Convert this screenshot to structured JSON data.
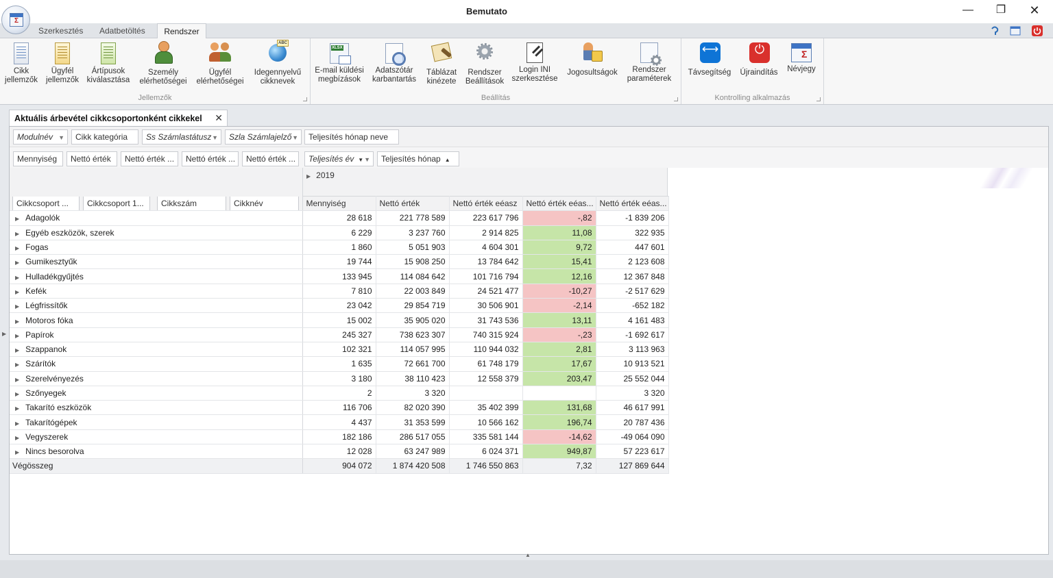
{
  "window": {
    "title": "Bemutato",
    "minimize": "—",
    "restore": "❐",
    "close": "✕"
  },
  "ribbon_tabs": [
    "Szerkesztés",
    "Adatbetöltés",
    "Rendszer"
  ],
  "ribbon_groups": [
    {
      "label": "Jellemzők",
      "buttons": [
        {
          "label1": "Cikk",
          "label2": "jellemzők",
          "icon": "document-icon"
        },
        {
          "label1": "Ügyfél",
          "label2": "jellemzők",
          "icon": "document-yellow-icon"
        },
        {
          "label1": "Ártípusok",
          "label2": "kiválasztása",
          "icon": "document-green-icon"
        },
        {
          "label1": "Személy",
          "label2": "elérhetőségei",
          "icon": "person-icon"
        },
        {
          "label1": "Ügyfél",
          "label2": "elérhetőségei",
          "icon": "people-icon"
        },
        {
          "label1": "Idegennyelvű",
          "label2": "cikknevek",
          "icon": "globe-icon"
        }
      ]
    },
    {
      "label": "Beállítás",
      "buttons": [
        {
          "label1": "E-mail küldési",
          "label2": "megbízások",
          "icon": "email-icon"
        },
        {
          "label1": "Adatszótár",
          "label2": "karbantartás",
          "icon": "dictionary-icon"
        },
        {
          "label1": "Táblázat",
          "label2": "kinézete",
          "icon": "table-style-icon"
        },
        {
          "label1": "Rendszer",
          "label2": "Beállítások",
          "icon": "gear-icon"
        },
        {
          "label1": "Login INI",
          "label2": "szerkesztése",
          "icon": "ini-edit-icon"
        },
        {
          "label1": "Jogosultságok",
          "label2": "",
          "icon": "permissions-icon"
        },
        {
          "label1": "Rendszer",
          "label2": "paraméterek",
          "icon": "parameters-icon"
        }
      ]
    },
    {
      "label": "Kontrolling alkalmazás",
      "buttons": [
        {
          "label1": "Távsegítség",
          "label2": "",
          "icon": "teamviewer-icon"
        },
        {
          "label1": "Újraindítás",
          "label2": "",
          "icon": "power-icon"
        },
        {
          "label1": "Névjegy",
          "label2": "",
          "icon": "about-icon"
        }
      ]
    }
  ],
  "document_tab": {
    "title": "Aktuális árbevétel cikkcsoportonként cikkekel",
    "close": "✕"
  },
  "filter_fields": [
    "Modulnév",
    "Cikk kategória",
    "Ss Számlastátusz",
    "Szla Számlajelző",
    "Teljesítés hónap neve"
  ],
  "data_fields": [
    "Mennyiség",
    "Nettó érték",
    "Nettó érték ...",
    "Nettó érték ...",
    "Nettó érték ..."
  ],
  "column_fields": [
    "Teljesítés év",
    "Teljesítés hónap"
  ],
  "row_fields": [
    "Cikkcsoport ...",
    "Cikkcsoport 1...",
    "Cikkszám",
    "Cikknév"
  ],
  "year": "2019",
  "column_headers": [
    "Mennyiség",
    "Nettó érték",
    "Nettó érték eéasz",
    "Nettó érték eéas...",
    "Nettó érték eéas..."
  ],
  "rows": [
    {
      "name": "Adagolók",
      "v": [
        "28 618",
        "221 778 589",
        "223 617 796",
        "-,82",
        "-1 839 206"
      ],
      "s": "neg"
    },
    {
      "name": "Egyéb eszközök, szerek",
      "v": [
        "6 229",
        "3 237 760",
        "2 914 825",
        "11,08",
        "322 935"
      ],
      "s": "pos"
    },
    {
      "name": "Fogas",
      "v": [
        "1 860",
        "5 051 903",
        "4 604 301",
        "9,72",
        "447 601"
      ],
      "s": "pos"
    },
    {
      "name": "Gumikesztyűk",
      "v": [
        "19 744",
        "15 908 250",
        "13 784 642",
        "15,41",
        "2 123 608"
      ],
      "s": "pos"
    },
    {
      "name": "Hulladékgyűjtés",
      "v": [
        "133 945",
        "114 084 642",
        "101 716 794",
        "12,16",
        "12 367 848"
      ],
      "s": "pos"
    },
    {
      "name": "Kefék",
      "v": [
        "7 810",
        "22 003 849",
        "24 521 477",
        "-10,27",
        "-2 517 629"
      ],
      "s": "neg"
    },
    {
      "name": "Légfrissítők",
      "v": [
        "23 042",
        "29 854 719",
        "30 506 901",
        "-2,14",
        "-652 182"
      ],
      "s": "neg"
    },
    {
      "name": "Motoros fóka",
      "v": [
        "15 002",
        "35 905 020",
        "31 743 536",
        "13,11",
        "4 161 483"
      ],
      "s": "pos"
    },
    {
      "name": "Papírok",
      "v": [
        "245 327",
        "738 623 307",
        "740 315 924",
        "-,23",
        "-1 692 617"
      ],
      "s": "neg"
    },
    {
      "name": "Szappanok",
      "v": [
        "102 321",
        "114 057 995",
        "110 944 032",
        "2,81",
        "3 113 963"
      ],
      "s": "pos"
    },
    {
      "name": "Szárítók",
      "v": [
        "1 635",
        "72 661 700",
        "61 748 179",
        "17,67",
        "10 913 521"
      ],
      "s": "pos"
    },
    {
      "name": "Szerelvényezés",
      "v": [
        "3 180",
        "38 110 423",
        "12 558 379",
        "203,47",
        "25 552 044"
      ],
      "s": "pos"
    },
    {
      "name": "Szőnyegek",
      "v": [
        "2",
        "3 320",
        "",
        "",
        "3 320"
      ],
      "s": "none"
    },
    {
      "name": "Takarító eszközök",
      "v": [
        "116 706",
        "82 020 390",
        "35 402 399",
        "131,68",
        "46 617 991"
      ],
      "s": "pos"
    },
    {
      "name": "Takarítógépek",
      "v": [
        "4 437",
        "31 353 599",
        "10 566 162",
        "196,74",
        "20 787 436"
      ],
      "s": "pos"
    },
    {
      "name": "Vegyszerek",
      "v": [
        "182 186",
        "286 517 055",
        "335 581 144",
        "-14,62",
        "-49 064 090"
      ],
      "s": "neg"
    },
    {
      "name": "Nincs besorolva",
      "v": [
        "12 028",
        "63 247 989",
        "6 024 371",
        "949,87",
        "57 223 617"
      ],
      "s": "pos"
    }
  ],
  "total": {
    "name": "Végösszeg",
    "v": [
      "904 072",
      "1 874 420 508",
      "1 746 550 863",
      "7,32",
      "127 869 644"
    ]
  },
  "colors": {
    "positive": "#c6e5a8",
    "negative": "#f5c4c4"
  }
}
